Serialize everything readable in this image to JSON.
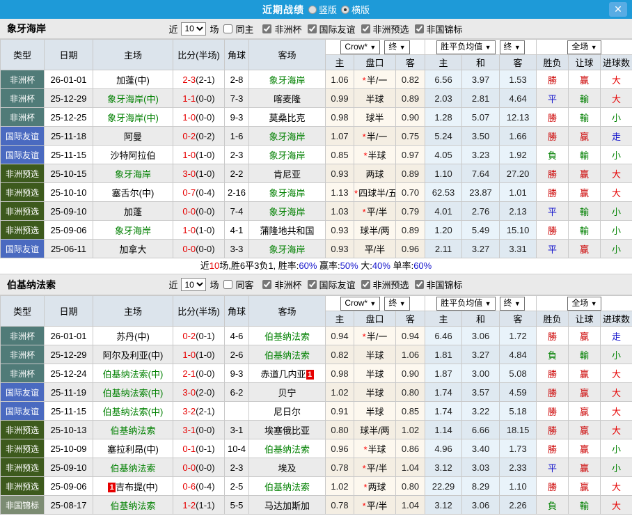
{
  "titlebar": {
    "title": "近期战绩",
    "radio_vertical": "竖版",
    "radio_horizontal": "横版",
    "close": "✕"
  },
  "table_header": {
    "main_cols": [
      "类型",
      "日期",
      "主场",
      "比分(半场)",
      "角球",
      "客场"
    ],
    "sub_cols": [
      "主",
      "盘口",
      "客",
      "主",
      "和",
      "客",
      "胜负",
      "让球",
      "进球数"
    ],
    "select_odds_company": "Crow*",
    "select_final_1": "终",
    "select_wdl_avg": "胜平负均值",
    "select_final_2": "终",
    "select_fulltime": "全场"
  },
  "filter": {
    "near_label": "近",
    "games_value": "10",
    "games_label": "场",
    "competitions": [
      "非洲杯",
      "国际友谊",
      "非洲预选",
      "非国锦标"
    ]
  },
  "type_colors": {
    "非洲杯": "#507b78",
    "国际友谊": "#4a6ac0",
    "非洲预选": "#3d5a1d",
    "非国锦标": "#7c8c73"
  },
  "result_colors": {
    "勝": "#cc0000",
    "平": "#1414cc",
    "負": "#008000",
    "赢": "#cc0000",
    "輸": "#008000",
    "走": "#1414cc",
    "大": "#e60000",
    "小": "#008000"
  },
  "teams": [
    {
      "name": "象牙海岸",
      "same_label": "同主",
      "same_checked": false,
      "matches": [
        {
          "type": "非洲杯",
          "date": "26-01-01",
          "home": {
            "t": "加蓬(中)"
          },
          "score": "2-3",
          "half": "(2-1)",
          "corner": "2-8",
          "away": {
            "t": "象牙海岸",
            "g": 1
          },
          "o1": "1.06",
          "hc": "*半/一",
          "o2": "0.82",
          "w": "6.56",
          "d": "3.97",
          "l": "1.53",
          "r": [
            "勝",
            "赢",
            "大"
          ]
        },
        {
          "type": "非洲杯",
          "date": "25-12-29",
          "home": {
            "t": "象牙海岸(中)",
            "g": 1
          },
          "score": "1-1",
          "half": "(0-0)",
          "corner": "7-3",
          "away": {
            "t": "喀麦隆"
          },
          "o1": "0.99",
          "hc": "半球",
          "o2": "0.89",
          "w": "2.03",
          "d": "2.81",
          "l": "4.64",
          "r": [
            "平",
            "輸",
            "大"
          ]
        },
        {
          "type": "非洲杯",
          "date": "25-12-25",
          "home": {
            "t": "象牙海岸(中)",
            "g": 1
          },
          "score": "1-0",
          "half": "(0-0)",
          "corner": "9-3",
          "away": {
            "t": "莫桑比克"
          },
          "o1": "0.98",
          "hc": "球半",
          "o2": "0.90",
          "w": "1.28",
          "d": "5.07",
          "l": "12.13",
          "r": [
            "勝",
            "輸",
            "小"
          ]
        },
        {
          "type": "国际友谊",
          "date": "25-11-18",
          "home": {
            "t": "阿曼"
          },
          "score": "0-2",
          "half": "(0-2)",
          "corner": "1-6",
          "away": {
            "t": "象牙海岸",
            "g": 1
          },
          "o1": "1.07",
          "hc": "*半/一",
          "o2": "0.75",
          "w": "5.24",
          "d": "3.50",
          "l": "1.66",
          "r": [
            "勝",
            "赢",
            "走"
          ]
        },
        {
          "type": "国际友谊",
          "date": "25-11-15",
          "home": {
            "t": "沙特阿拉伯"
          },
          "score": "1-0",
          "half": "(1-0)",
          "corner": "2-3",
          "away": {
            "t": "象牙海岸",
            "g": 1
          },
          "o1": "0.85",
          "hc": "*半球",
          "o2": "0.97",
          "w": "4.05",
          "d": "3.23",
          "l": "1.92",
          "r": [
            "負",
            "輸",
            "小"
          ]
        },
        {
          "type": "非洲预选",
          "date": "25-10-15",
          "home": {
            "t": "象牙海岸",
            "g": 1
          },
          "score": "3-0",
          "half": "(1-0)",
          "corner": "2-2",
          "away": {
            "t": "肯尼亚"
          },
          "o1": "0.93",
          "hc": "两球",
          "o2": "0.89",
          "w": "1.10",
          "d": "7.64",
          "l": "27.20",
          "r": [
            "勝",
            "赢",
            "大"
          ]
        },
        {
          "type": "非洲预选",
          "date": "25-10-10",
          "home": {
            "t": "塞舌尔(中)"
          },
          "score": "0-7",
          "half": "(0-4)",
          "corner": "2-16",
          "away": {
            "t": "象牙海岸",
            "g": 1
          },
          "o1": "1.13",
          "hc": "*四球半/五",
          "o2": "0.70",
          "w": "62.53",
          "d": "23.87",
          "l": "1.01",
          "r": [
            "勝",
            "赢",
            "大"
          ]
        },
        {
          "type": "非洲预选",
          "date": "25-09-10",
          "home": {
            "t": "加蓬"
          },
          "score": "0-0",
          "half": "(0-0)",
          "corner": "7-4",
          "away": {
            "t": "象牙海岸",
            "g": 1
          },
          "o1": "1.03",
          "hc": "*平/半",
          "o2": "0.79",
          "w": "4.01",
          "d": "2.76",
          "l": "2.13",
          "r": [
            "平",
            "輸",
            "小"
          ]
        },
        {
          "type": "非洲预选",
          "date": "25-09-06",
          "home": {
            "t": "象牙海岸",
            "g": 1
          },
          "score": "1-0",
          "half": "(1-0)",
          "corner": "4-1",
          "away": {
            "t": "蒲隆地共和国"
          },
          "o1": "0.93",
          "hc": "球半/两",
          "o2": "0.89",
          "w": "1.20",
          "d": "5.49",
          "l": "15.10",
          "r": [
            "勝",
            "輸",
            "小"
          ]
        },
        {
          "type": "国际友谊",
          "date": "25-06-11",
          "home": {
            "t": "加拿大"
          },
          "score": "0-0",
          "half": "(0-0)",
          "corner": "3-3",
          "away": {
            "t": "象牙海岸",
            "g": 1
          },
          "o1": "0.93",
          "hc": "平/半",
          "o2": "0.96",
          "w": "2.11",
          "d": "3.27",
          "l": "3.31",
          "r": [
            "平",
            "赢",
            "小"
          ]
        }
      ],
      "summary": {
        "t1": "近",
        "n": "10",
        "t2": "场,胜6平3负1, 胜率:",
        "p1": "60%",
        "t3": " 赢率:",
        "p2": "50%",
        "t4": " 大:",
        "p3": "40%",
        "t5": " 单率:",
        "p4": "60%"
      }
    },
    {
      "name": "伯基纳法索",
      "same_label": "同客",
      "same_checked": false,
      "matches": [
        {
          "type": "非洲杯",
          "date": "26-01-01",
          "home": {
            "t": "苏丹(中)"
          },
          "score": "0-2",
          "half": "(0-1)",
          "corner": "4-6",
          "away": {
            "t": "伯基纳法索",
            "g": 1
          },
          "o1": "0.94",
          "hc": "*半/一",
          "o2": "0.94",
          "w": "6.46",
          "d": "3.06",
          "l": "1.72",
          "r": [
            "勝",
            "赢",
            "走"
          ]
        },
        {
          "type": "非洲杯",
          "date": "25-12-29",
          "home": {
            "t": "阿尔及利亚(中)"
          },
          "score": "1-0",
          "half": "(1-0)",
          "corner": "2-6",
          "away": {
            "t": "伯基纳法索",
            "g": 1
          },
          "o1": "0.82",
          "hc": "半球",
          "o2": "1.06",
          "w": "1.81",
          "d": "3.27",
          "l": "4.84",
          "r": [
            "負",
            "輸",
            "小"
          ]
        },
        {
          "type": "非洲杯",
          "date": "25-12-24",
          "home": {
            "t": "伯基纳法索(中)",
            "g": 1
          },
          "score": "2-1",
          "half": "(0-0)",
          "corner": "9-3",
          "away": {
            "t": "赤道几内亚",
            "b": "1",
            "bp": "after"
          },
          "o1": "0.98",
          "hc": "半球",
          "o2": "0.90",
          "w": "1.87",
          "d": "3.00",
          "l": "5.08",
          "r": [
            "勝",
            "赢",
            "大"
          ]
        },
        {
          "type": "国际友谊",
          "date": "25-11-19",
          "home": {
            "t": "伯基纳法索(中)",
            "g": 1
          },
          "score": "3-0",
          "half": "(2-0)",
          "corner": "6-2",
          "away": {
            "t": "贝宁"
          },
          "o1": "1.02",
          "hc": "半球",
          "o2": "0.80",
          "w": "1.74",
          "d": "3.57",
          "l": "4.59",
          "r": [
            "勝",
            "赢",
            "大"
          ]
        },
        {
          "type": "国际友谊",
          "date": "25-11-15",
          "home": {
            "t": "伯基纳法索(中)",
            "g": 1
          },
          "score": "3-2",
          "half": "(2-1)",
          "corner": "",
          "away": {
            "t": "尼日尔"
          },
          "o1": "0.91",
          "hc": "半球",
          "o2": "0.85",
          "w": "1.74",
          "d": "3.22",
          "l": "5.18",
          "r": [
            "勝",
            "赢",
            "大"
          ]
        },
        {
          "type": "非洲预选",
          "date": "25-10-13",
          "home": {
            "t": "伯基纳法索",
            "g": 1
          },
          "score": "3-1",
          "half": "(0-0)",
          "corner": "3-1",
          "away": {
            "t": "埃塞俄比亚"
          },
          "o1": "0.80",
          "hc": "球半/两",
          "o2": "1.02",
          "w": "1.14",
          "d": "6.66",
          "l": "18.15",
          "r": [
            "勝",
            "赢",
            "大"
          ]
        },
        {
          "type": "非洲预选",
          "date": "25-10-09",
          "home": {
            "t": "塞拉利昂(中)"
          },
          "score": "0-1",
          "half": "(0-1)",
          "corner": "10-4",
          "away": {
            "t": "伯基纳法索",
            "g": 1
          },
          "o1": "0.96",
          "hc": "*半球",
          "o2": "0.86",
          "w": "4.96",
          "d": "3.40",
          "l": "1.73",
          "r": [
            "勝",
            "赢",
            "小"
          ]
        },
        {
          "type": "非洲预选",
          "date": "25-09-10",
          "home": {
            "t": "伯基纳法索",
            "g": 1
          },
          "score": "0-0",
          "half": "(0-0)",
          "corner": "2-3",
          "away": {
            "t": "埃及"
          },
          "o1": "0.78",
          "hc": "*平/半",
          "o2": "1.04",
          "w": "3.12",
          "d": "3.03",
          "l": "2.33",
          "r": [
            "平",
            "赢",
            "小"
          ]
        },
        {
          "type": "非洲预选",
          "date": "25-09-06",
          "home": {
            "t": "吉布提(中)",
            "b": "1",
            "bp": "before"
          },
          "score": "0-6",
          "half": "(0-4)",
          "corner": "2-5",
          "away": {
            "t": "伯基纳法索",
            "g": 1
          },
          "o1": "1.02",
          "hc": "*两球",
          "o2": "0.80",
          "w": "22.29",
          "d": "8.29",
          "l": "1.10",
          "r": [
            "勝",
            "赢",
            "大"
          ]
        },
        {
          "type": "非国锦标",
          "date": "25-08-17",
          "home": {
            "t": "伯基纳法索",
            "g": 1
          },
          "score": "1-2",
          "half": "(1-1)",
          "corner": "5-5",
          "away": {
            "t": "马达加斯加"
          },
          "o1": "0.78",
          "hc": "*平/半",
          "o2": "1.04",
          "w": "3.12",
          "d": "3.06",
          "l": "2.26",
          "r": [
            "負",
            "輸",
            "大"
          ]
        }
      ],
      "summary": null
    }
  ]
}
